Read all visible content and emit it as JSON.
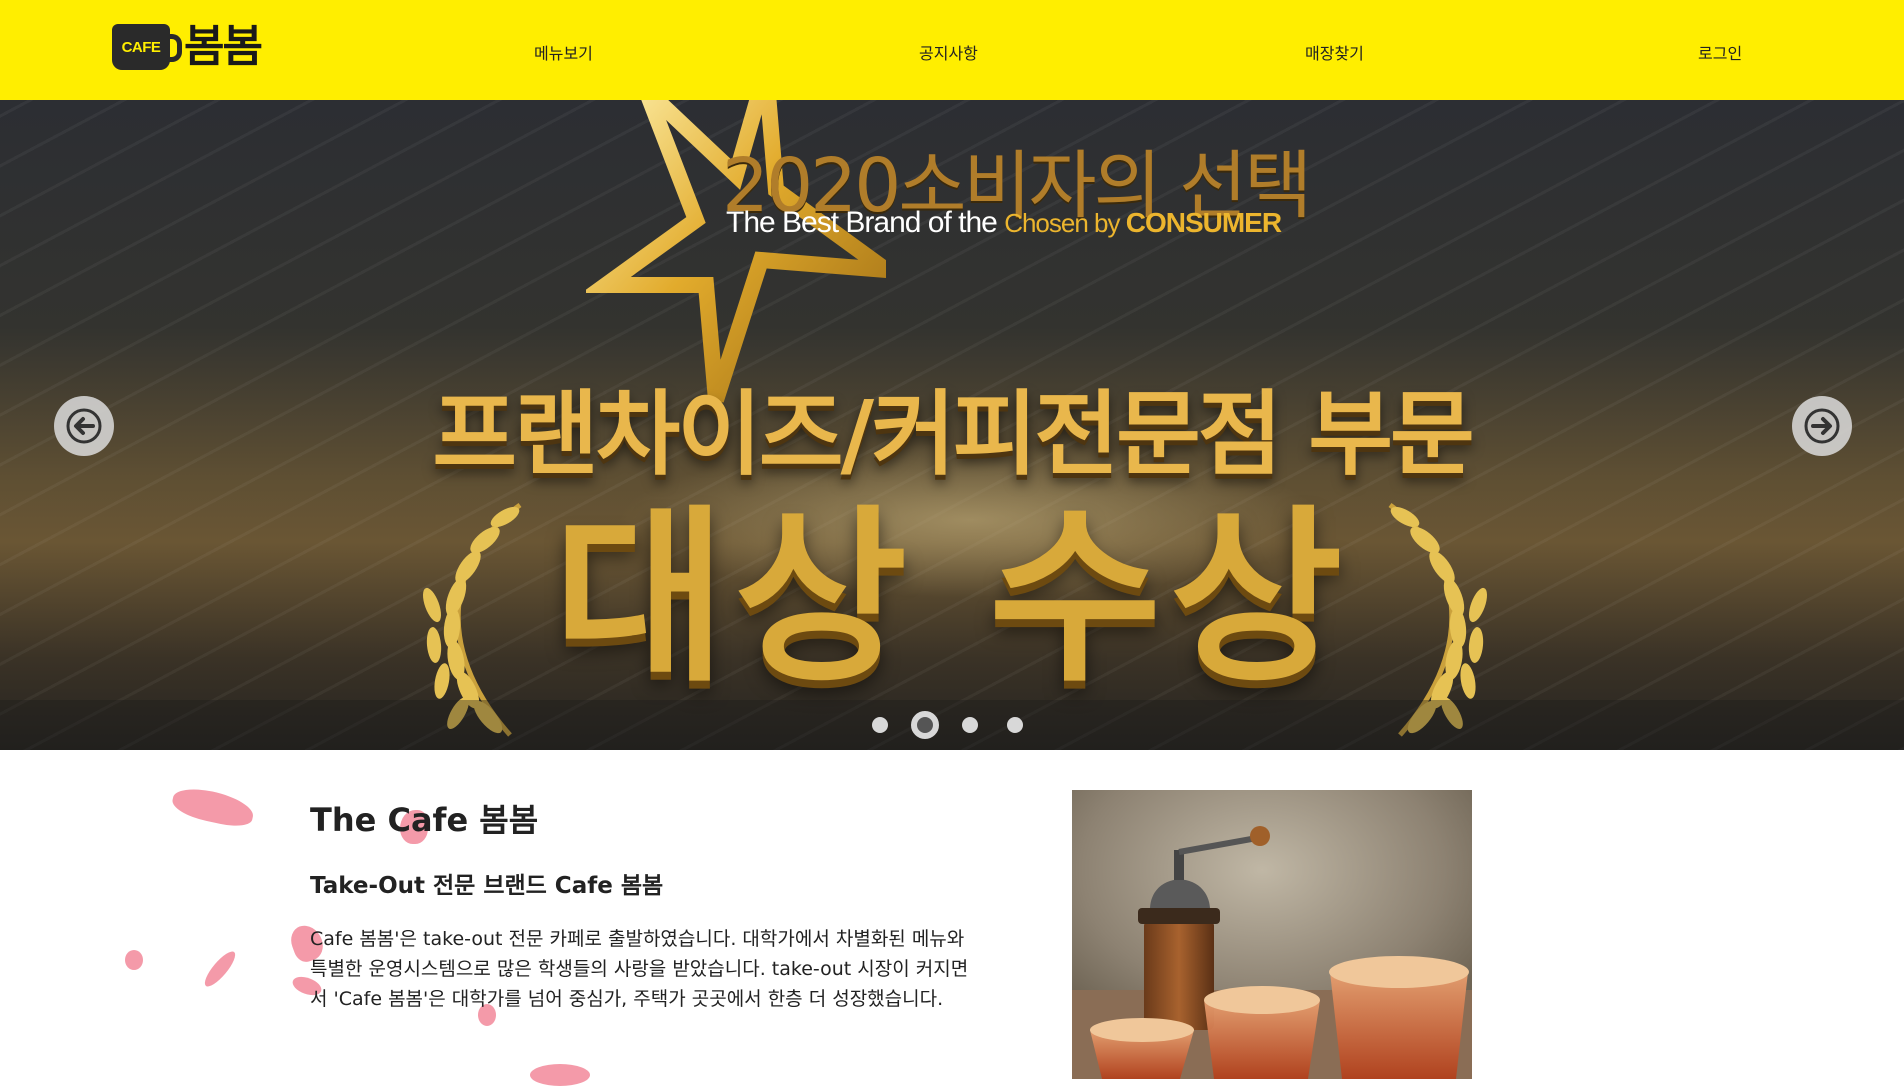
{
  "brand": {
    "logo_badge": "CAFE",
    "logo_text": "봄봄"
  },
  "nav": {
    "items": [
      {
        "label": "메뉴보기"
      },
      {
        "label": "공지사항"
      },
      {
        "label": "매장찾기"
      },
      {
        "label": "로그인"
      }
    ]
  },
  "banner": {
    "award_title": "2020소비자의 선택",
    "award_sub_white": "The Best Brand of the",
    "award_sub_gold_pre": "Chosen by",
    "award_sub_gold_bold": "CONSUMER",
    "category": "프랜차이즈/커피전문점 부문",
    "grand_prize": "대상 수상",
    "slides_total": 4,
    "active_slide": 2,
    "prev_icon": "arrow-left-icon",
    "next_icon": "arrow-right-icon"
  },
  "intro": {
    "title": "The Cafe 봄봄",
    "subtitle": "Take-Out 전문 브랜드 Cafe 봄봄",
    "body": "Cafe 봄봄'은 take-out 전문 카페로 출발하였습니다. 대학가에서 차별화된 메뉴와 특별한 운영시스템으로 많은 학생들의 사랑을 받았습니다. take-out 시장이 커지면서 'Cafe 봄봄'은 대학가를 넘어 중심가, 주택가 곳곳에서 한층 더 성장했습니다."
  },
  "colors": {
    "header_bg": "#ffee00",
    "gold": "#d8a93a",
    "text": "#222222",
    "petal": "#f0788c"
  }
}
